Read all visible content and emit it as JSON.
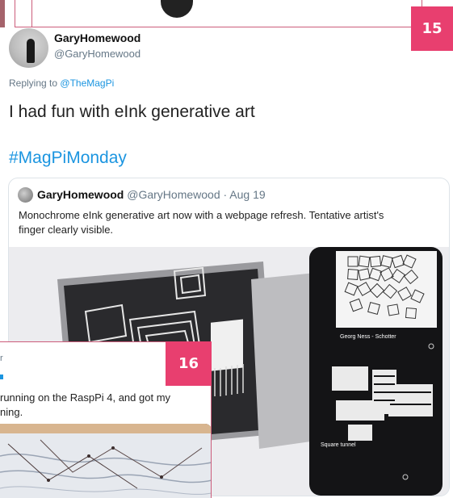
{
  "badges": {
    "previous": "15",
    "current": "16"
  },
  "tweet": {
    "display_name": "GaryHomewood",
    "handle": "@GaryHomewood",
    "replying_prefix": "Replying to",
    "replying_to": "@TheMagPi",
    "text": "I had fun with eInk generative art",
    "hashtag": "#MagPiMonday"
  },
  "quoted_tweet": {
    "display_name": "GaryHomewood",
    "meta": "@GaryHomewood · Aug 19",
    "text_line1": "Monochrome eInk generative art now with a webpage refresh. Tentative artist's",
    "text_line2": "finger clearly visible.",
    "photo": {
      "phone_caption_top": "Georg Ness - Schotter",
      "phone_caption_bottom": "Square tunnel"
    }
  },
  "overlay_card": {
    "label_partial": "r",
    "text_line1": "running on the RaspPi 4, and got my",
    "text_line2": "ning."
  },
  "colors": {
    "accent": "#e83f6f",
    "link": "#1b95e0",
    "muted": "#657786",
    "frame": "#cc5d7b"
  }
}
